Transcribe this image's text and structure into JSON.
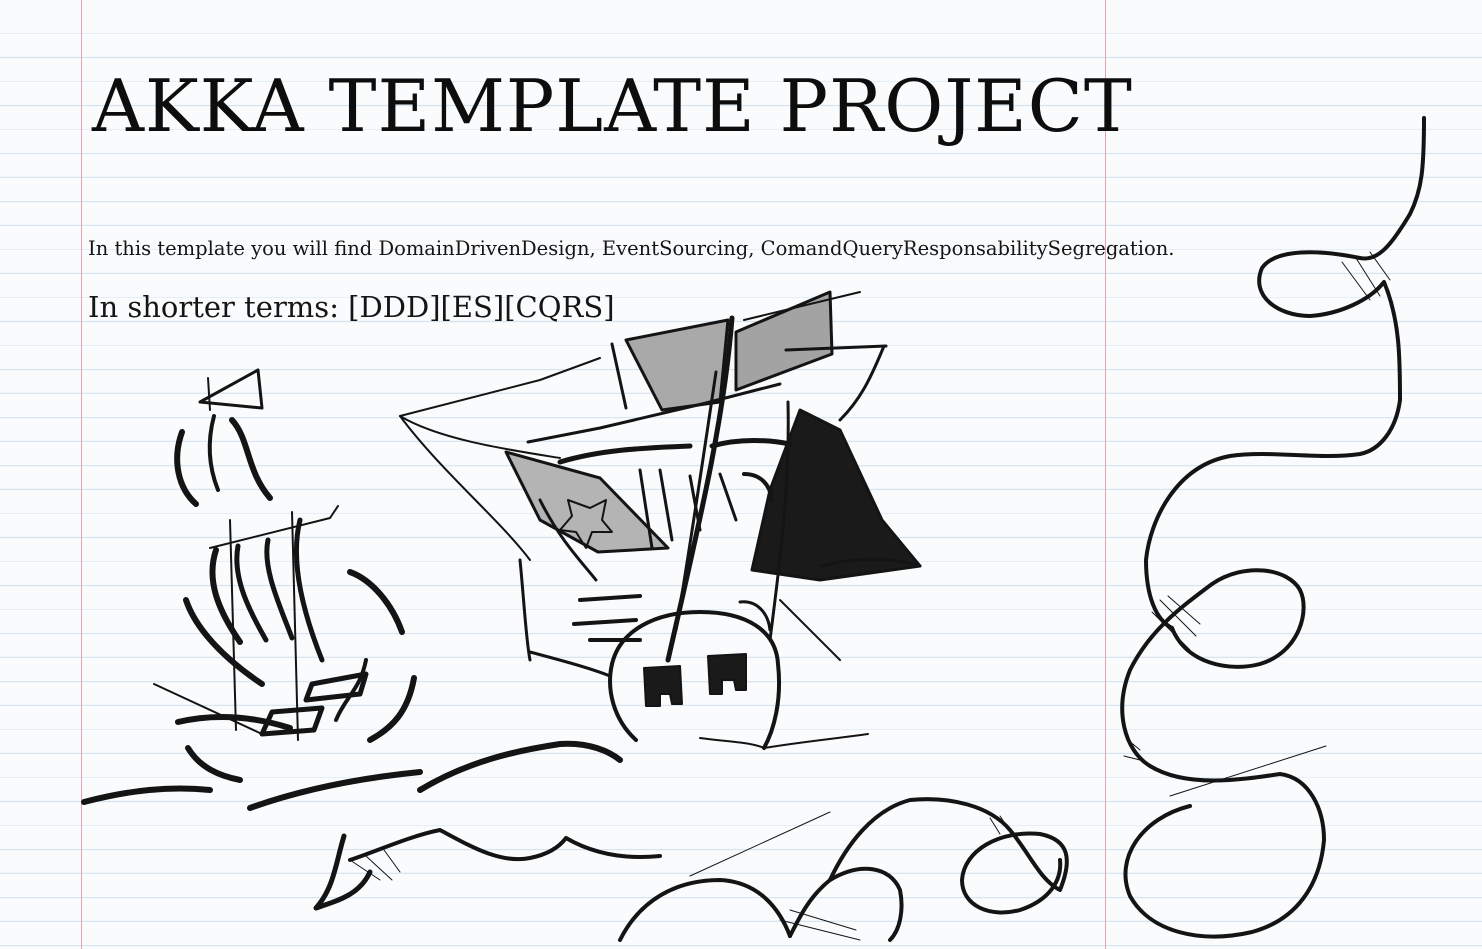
{
  "page": {
    "title": "AKKA TEMPLATE PROJECT",
    "intro_text": "In this template you will find DomainDrivenDesign, EventSourcing, ComandQueryResponsabilitySegregation.",
    "shorter_terms": "In shorter terms: [DDD][ES][CQRS]"
  },
  "colors": {
    "paper": "#fafbfc",
    "rule_line": "#d5e3f1",
    "margin_line": "#e3a3ad",
    "ink": "#111111",
    "sail_gray": "#a9a9a9"
  },
  "illustration": {
    "small_ship_icon": "ship-sketch-icon",
    "large_ship_icon": "galleon-sketch-icon",
    "waves_icon": "ocean-waves-sketch-icon",
    "sea_serpent_icon": "sea-serpent-sketch-icon"
  }
}
